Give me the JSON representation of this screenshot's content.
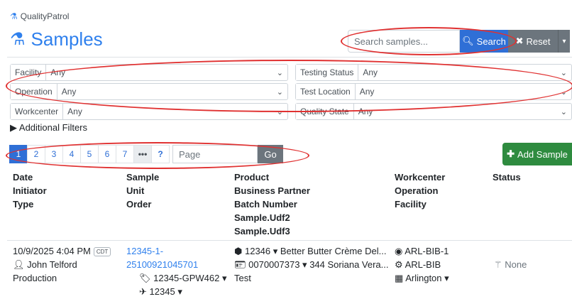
{
  "brand": "QualityPatrol",
  "page_title": "Samples",
  "search": {
    "placeholder": "Search samples...",
    "button": "Search",
    "reset": "Reset"
  },
  "filters": [
    {
      "label": "Facility",
      "value": "Any"
    },
    {
      "label": "Testing Status",
      "value": "Any"
    },
    {
      "label": "Operation",
      "value": "Any"
    },
    {
      "label": "Test Location",
      "value": "Any"
    },
    {
      "label": "Workcenter",
      "value": "Any"
    },
    {
      "label": "Quality State",
      "value": "Any"
    }
  ],
  "additional_filters": "Additional Filters",
  "pager": {
    "pages": [
      "1",
      "2",
      "3",
      "4",
      "5",
      "6",
      "7"
    ],
    "dots": "•••",
    "help": "?",
    "page_placeholder": "Page",
    "go": "Go"
  },
  "add_sample": "Add Sample",
  "columns": {
    "c1": [
      "Date",
      "Initiator",
      "Type"
    ],
    "c2": [
      "Sample",
      "Unit",
      "Order"
    ],
    "c3": [
      "Product",
      "Business Partner",
      "Batch Number",
      "Sample.Udf2",
      "Sample.Udf3"
    ],
    "c4": [
      "Workcenter",
      "Operation",
      "Facility"
    ],
    "c5": [
      "Status"
    ]
  },
  "row": {
    "date": "10/9/2025 4:04 PM",
    "tz": "CDT",
    "initiator": "John Telford",
    "type": "Production",
    "sample_line1": "12345-1-",
    "sample_line2": "25100921045701",
    "unit": "12345-GPW462",
    "order": "12345",
    "product": "12346  ▾  Better Butter Crème Del...",
    "partner": "0070007373  ▾  344 Soriana Vera...",
    "batch": "Test",
    "workcenter": "ARL-BIB-1",
    "operation": "ARL-BIB",
    "facility": "Arlington",
    "status": "None"
  }
}
